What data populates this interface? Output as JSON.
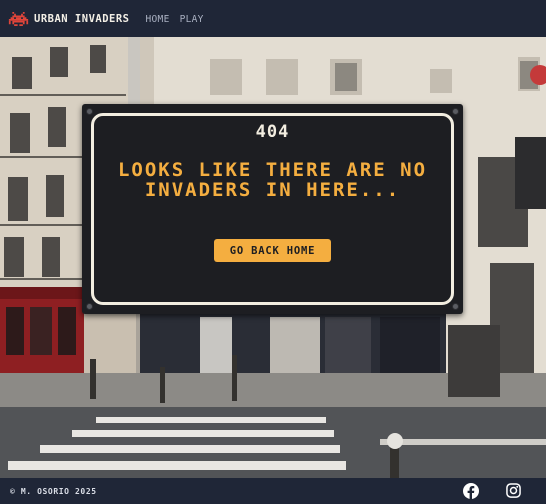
{
  "header": {
    "brand": "URBAN INVADERS",
    "logo_icon": "space-invader-icon",
    "nav": [
      {
        "label": "HOME"
      },
      {
        "label": "PLAY"
      }
    ]
  },
  "sign": {
    "code": "404",
    "message": "LOOKS LIKE THERE ARE NO INVADERS IN HERE...",
    "button_label": "GO BACK HOME"
  },
  "footer": {
    "copyright": "© M. OSORIO 2025",
    "social": [
      {
        "icon": "facebook-icon"
      },
      {
        "icon": "instagram-icon"
      }
    ]
  },
  "colors": {
    "bar": "#1f2637",
    "accent": "#f4ae40",
    "sign": "#1d1e22",
    "logo": "#e0453a"
  }
}
